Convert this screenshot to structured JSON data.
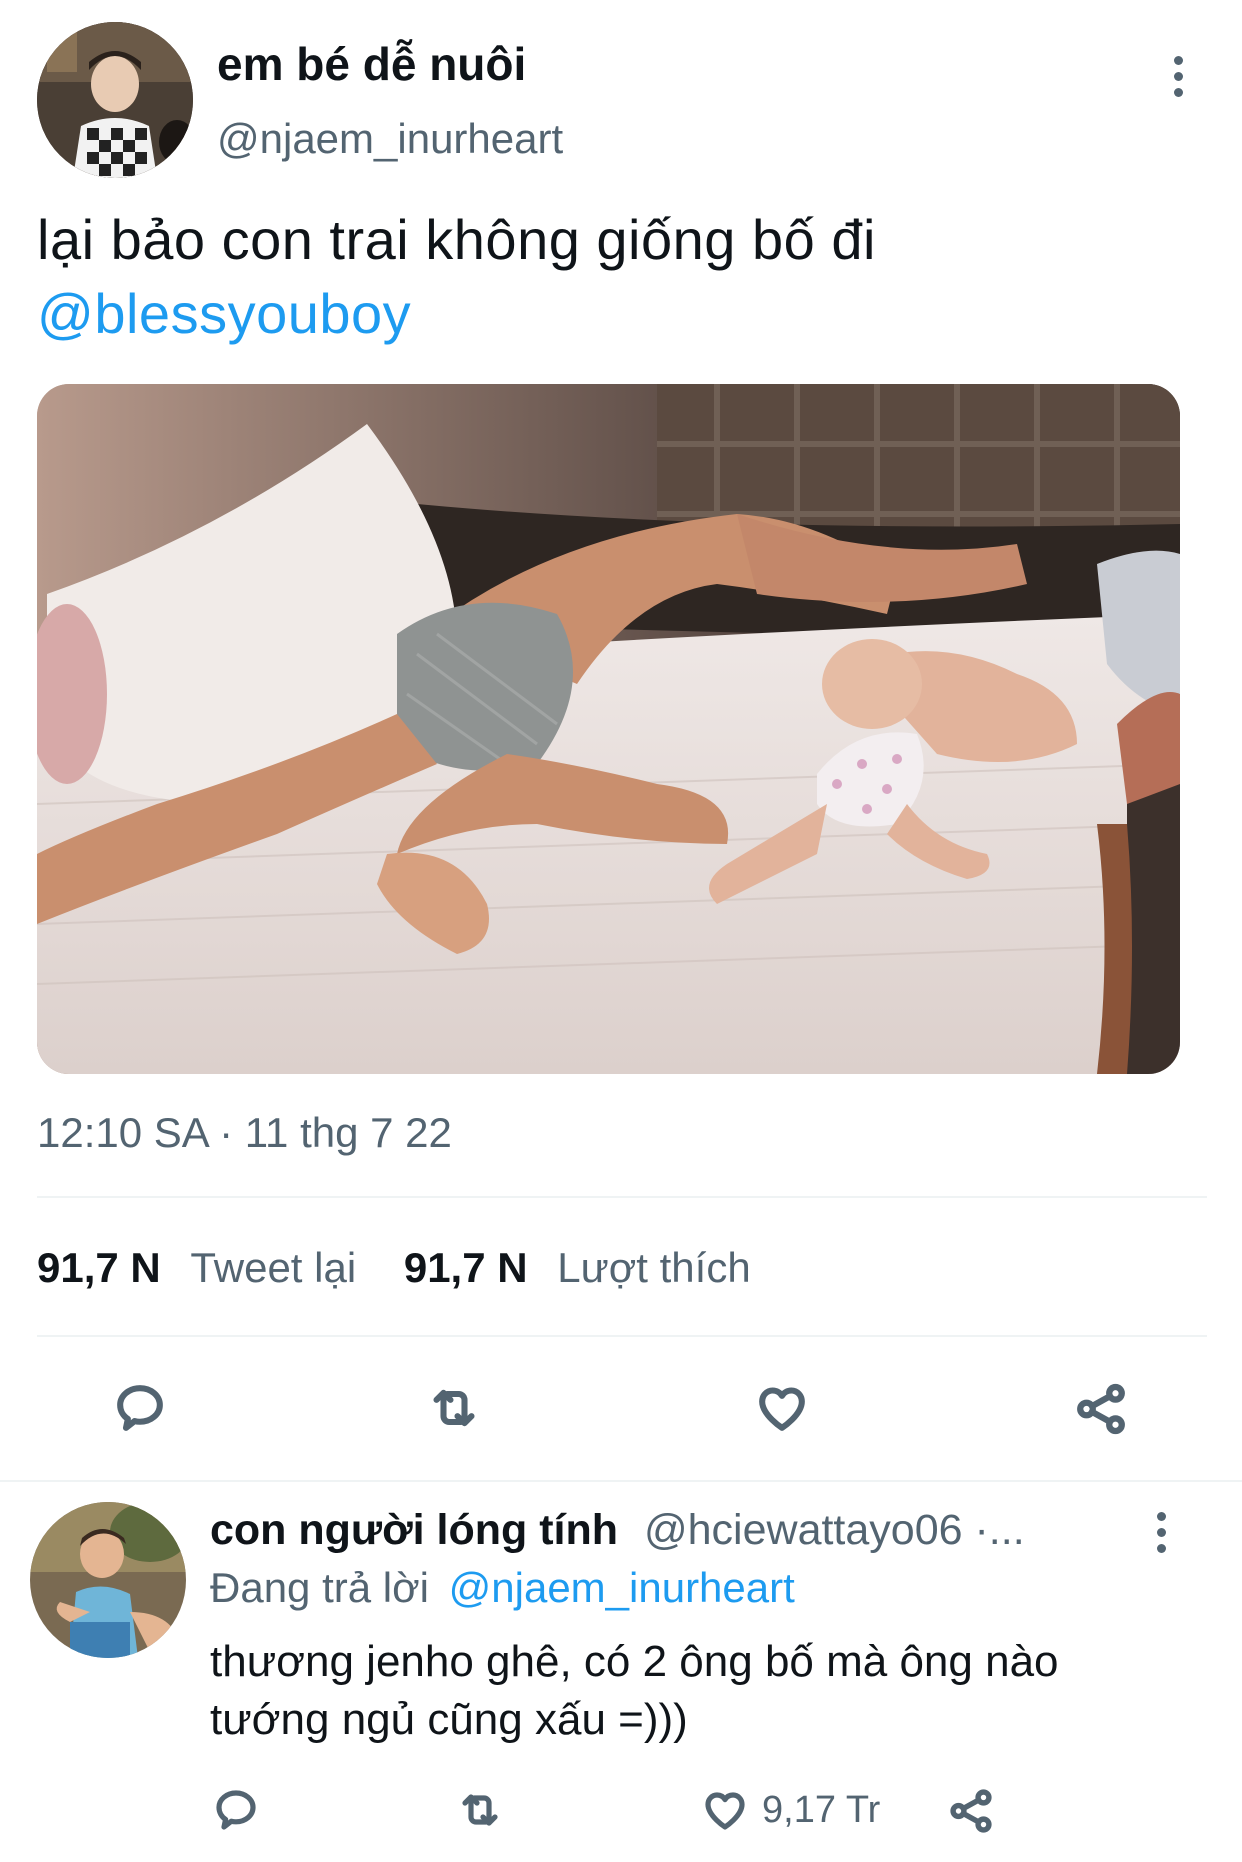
{
  "tweet": {
    "author_name": "em bé dễ nuôi",
    "author_handle": "@njaem_inurheart",
    "text_line1": "lại bảo con trai không giống bố đi",
    "mention": "@blessyouboy",
    "timestamp": "12:10 SA · 11 thg 7 22",
    "stats": {
      "retweets_count": "91,7 N",
      "retweets_label": "Tweet lại",
      "likes_count": "91,7 N",
      "likes_label": "Lượt thích"
    },
    "actions": [
      "reply-icon",
      "retweet-icon",
      "like-icon",
      "share-icon"
    ]
  },
  "reply": {
    "author_name": "con người lóng tính",
    "author_handle": "@hciewattayo06 ·...",
    "replying_label": "Đang trả lời",
    "replying_to": "@njaem_inurheart",
    "text_line1": "thương jenho ghê, có 2 ông bố mà ông nào",
    "text_line2": "tướng ngủ cũng xấu =)))",
    "like_count": "9,17 Tr",
    "actions": [
      "reply-icon",
      "retweet-icon",
      "like-icon",
      "share-icon"
    ]
  },
  "colors": {
    "link": "#1d9bf0",
    "muted": "#536471",
    "text": "#0f1419",
    "divider": "#eff3f4"
  }
}
